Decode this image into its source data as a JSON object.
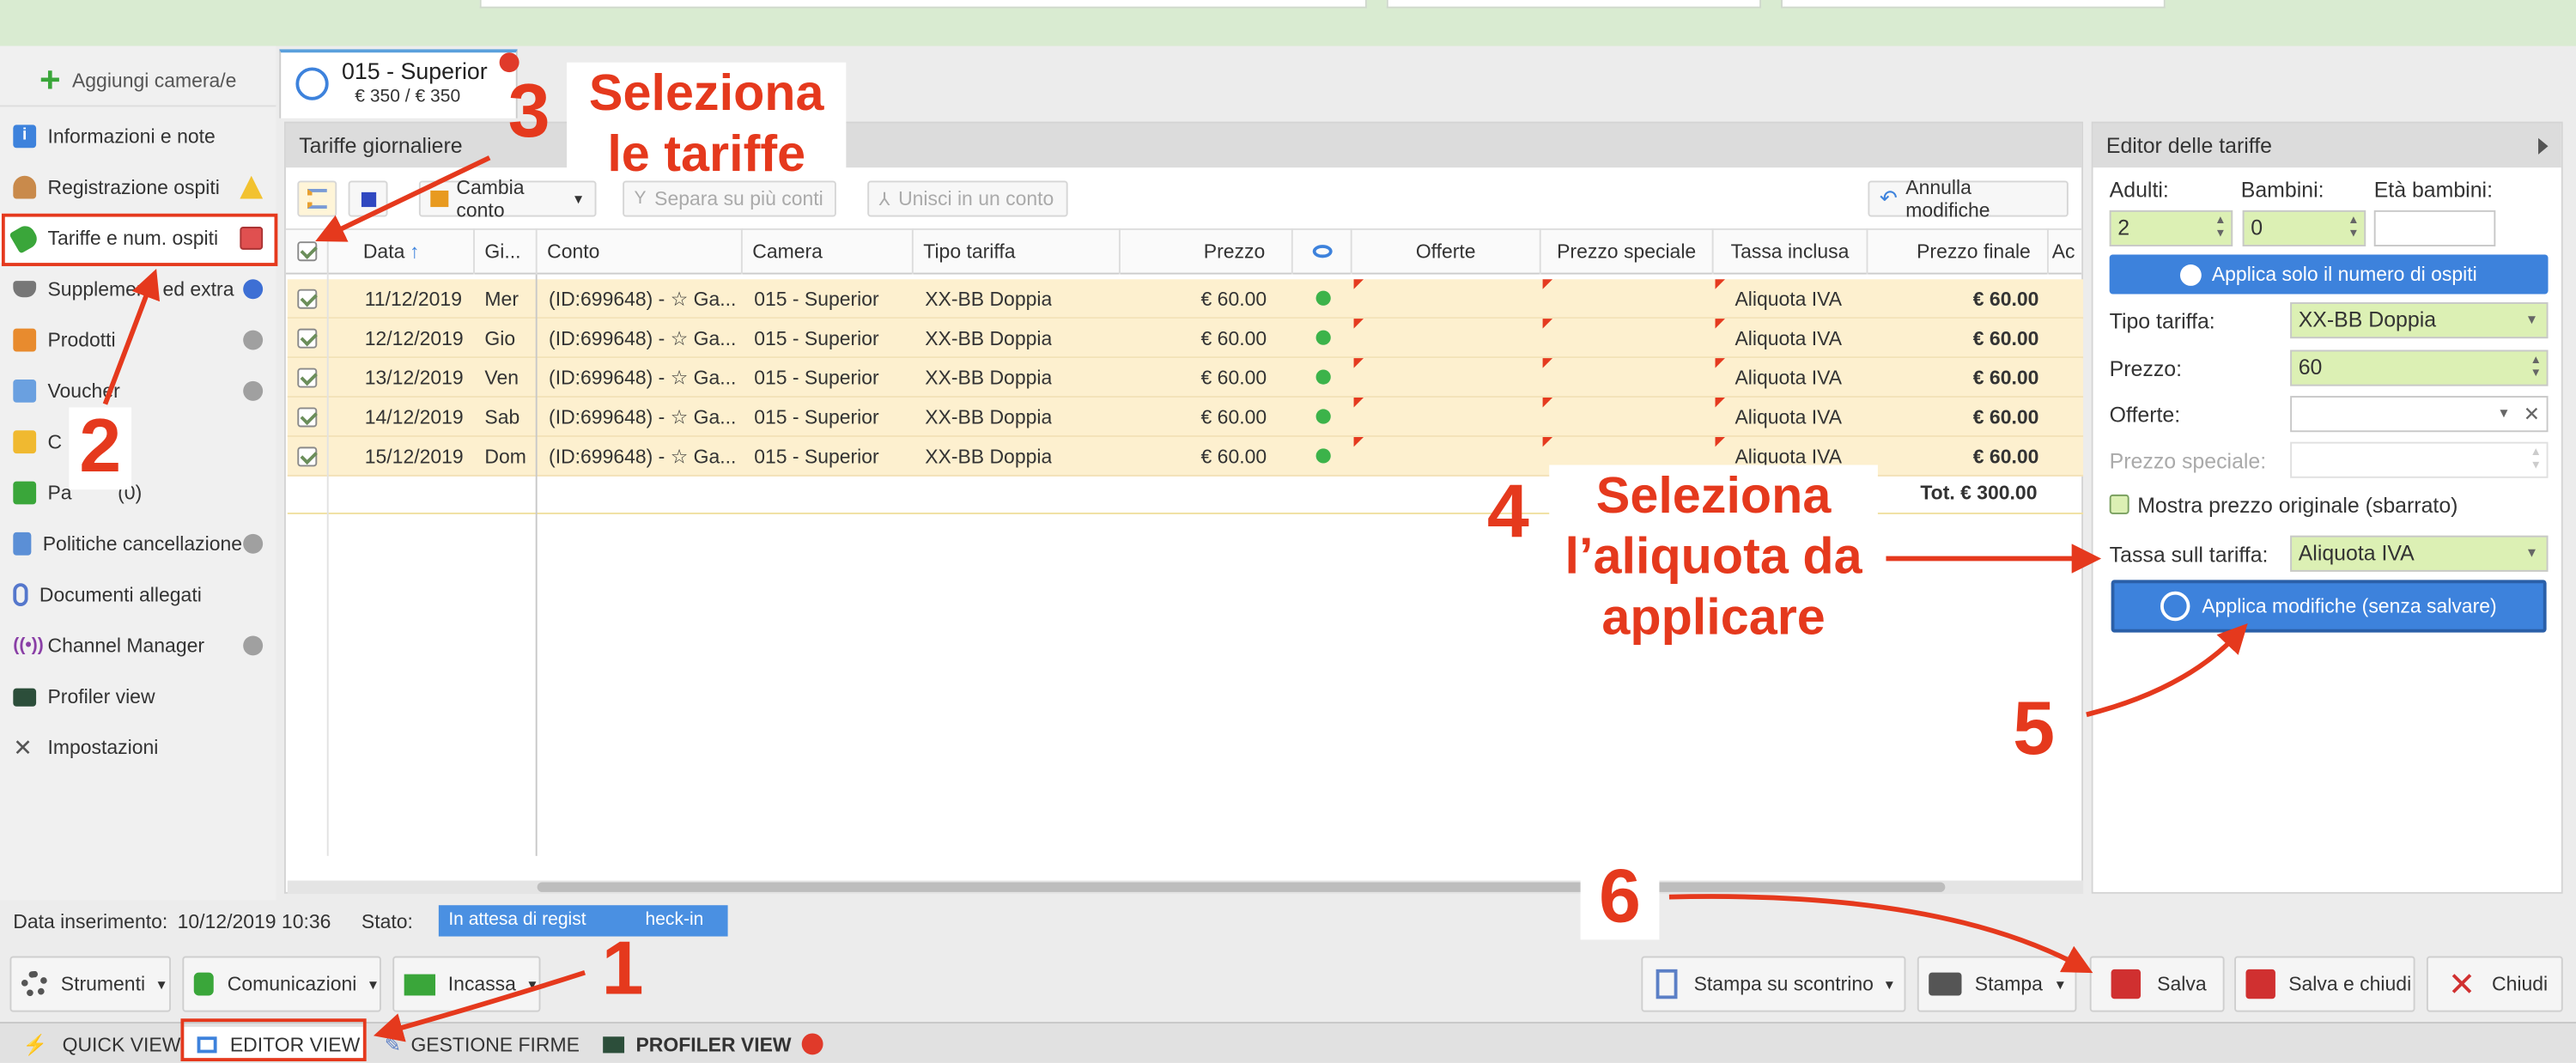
{
  "sidebar": {
    "add_room_label": "Aggiungi camera/e",
    "items": [
      {
        "label": "Informazioni e note"
      },
      {
        "label": "Registrazione ospiti"
      },
      {
        "label": "Tariffe e num. ospiti"
      },
      {
        "label": "Supplementi ed extra"
      },
      {
        "label": "Prodotti"
      },
      {
        "label": "Voucher"
      },
      {
        "label": "C"
      },
      {
        "label": "Pa",
        "count": "(0)"
      },
      {
        "label": "Politiche cancellazione"
      },
      {
        "label": "Documenti allegati"
      },
      {
        "label": "Channel Manager"
      },
      {
        "label": "Profiler view"
      },
      {
        "label": "Impostazioni"
      }
    ]
  },
  "room_tab": {
    "title": "015 - Superior",
    "price": "€ 350 / € 350"
  },
  "tariffs_panel": {
    "title": "Tariffe giornaliere",
    "toolbar": {
      "change_account": "Cambia conto",
      "split_accounts": "Separa su più conti",
      "merge_account": "Unisci in un conto",
      "undo_changes": "Annulla modifiche"
    },
    "columns": [
      "Data",
      "Gi...",
      "Conto",
      "Camera",
      "Tipo tariffa",
      "Prezzo",
      "Offerte",
      "Prezzo speciale",
      "Tassa inclusa",
      "Prezzo finale",
      "Ac"
    ],
    "rows": [
      {
        "date": "11/12/2019",
        "day": "Mer",
        "account": "(ID:699648) - ☆ Ga...",
        "room": "015 - Superior",
        "rate_type": "XX-BB Doppia",
        "price": "€ 60.00",
        "tax": "Aliquota IVA",
        "final_price": "€ 60.00"
      },
      {
        "date": "12/12/2019",
        "day": "Gio",
        "account": "(ID:699648) - ☆ Ga...",
        "room": "015 - Superior",
        "rate_type": "XX-BB Doppia",
        "price": "€ 60.00",
        "tax": "Aliquota IVA",
        "final_price": "€ 60.00"
      },
      {
        "date": "13/12/2019",
        "day": "Ven",
        "account": "(ID:699648) - ☆ Ga...",
        "room": "015 - Superior",
        "rate_type": "XX-BB Doppia",
        "price": "€ 60.00",
        "tax": "Aliquota IVA",
        "final_price": "€ 60.00"
      },
      {
        "date": "14/12/2019",
        "day": "Sab",
        "account": "(ID:699648) - ☆ Ga...",
        "room": "015 - Superior",
        "rate_type": "XX-BB Doppia",
        "price": "€ 60.00",
        "tax": "Aliquota IVA",
        "final_price": "€ 60.00"
      },
      {
        "date": "15/12/2019",
        "day": "Dom",
        "account": "(ID:699648) - ☆ Ga...",
        "room": "015 - Superior",
        "rate_type": "XX-BB Doppia",
        "price": "€ 60.00",
        "tax": "Aliquota IVA",
        "final_price": "€ 60.00"
      }
    ],
    "total": "Tot. € 300.00"
  },
  "editor": {
    "title": "Editor delle tariffe",
    "adults_label": "Adulti:",
    "adults_value": "2",
    "children_label": "Bambini:",
    "children_value": "0",
    "children_age_label": "Età bambini:",
    "children_age_value": "",
    "apply_guests_button": "Applica solo il numero di ospiti",
    "rate_type_label": "Tipo tariffa:",
    "rate_type_value": "XX-BB Doppia",
    "price_label": "Prezzo:",
    "price_value": "60",
    "offers_label": "Offerte:",
    "offers_value": "",
    "special_price_label": "Prezzo speciale:",
    "show_original_label": "Mostra prezzo originale (sbarrato)",
    "tax_label": "Tassa sull tariffa:",
    "tax_value": "Aliquota IVA",
    "apply_button": "Applica modifiche (senza salvare)"
  },
  "info": {
    "date_label": "Data inserimento:",
    "date_value": "10/12/2019 10:36",
    "status_label": "Stato:",
    "status_value_a": "In attesa di regist",
    "status_value_b": "heck-in"
  },
  "footer": {
    "tools": "Strumenti",
    "communications": "Comunicazioni",
    "collect": "Incassa",
    "print_receipt": "Stampa su scontrino",
    "print": "Stampa",
    "save": "Salva",
    "save_close": "Salva e chiudi",
    "close": "Chiudi"
  },
  "bottom_tabs": {
    "quick": "QUICK VIEW",
    "editor": "EDITOR VIEW",
    "signatures": "GESTIONE FIRME",
    "profiler": "PROFILER VIEW"
  },
  "annotations": {
    "n1": "1",
    "n2": "2",
    "n3": "3",
    "n4": "4",
    "n5": "5",
    "n6": "6",
    "t3_line1": "Seleziona",
    "t3_line2": "le tariffe",
    "t4_line1": "Seleziona",
    "t4_line2": "l’aliquota da",
    "t4_line3": "applicare"
  },
  "colors": {
    "accent": "#3d82dc",
    "annotation": "#e5391d",
    "row_highlight": "#fdf0cf",
    "field_highlight": "#dcf0b4"
  }
}
